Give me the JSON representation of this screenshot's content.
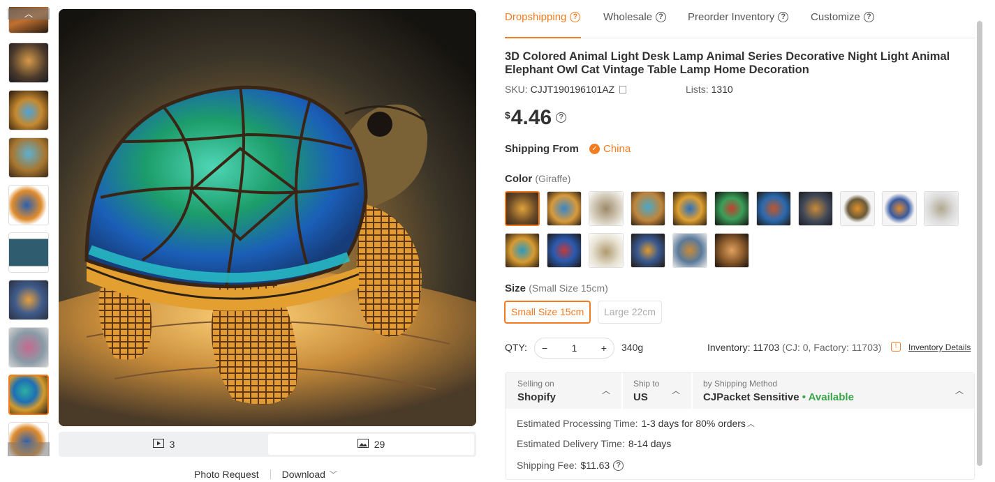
{
  "gallery": {
    "thumbnails": [
      "thumb-1",
      "thumb-2",
      "thumb-3",
      "thumb-4",
      "thumb-5",
      "thumb-6",
      "thumb-7",
      "thumb-8",
      "thumb-9",
      "thumb-10"
    ],
    "active_thumbnail": 9,
    "video_count": "3",
    "image_count": "29",
    "photo_request": "Photo Request",
    "download": "Download"
  },
  "tabs": [
    {
      "label": "Dropshipping",
      "active": true
    },
    {
      "label": "Wholesale",
      "active": false
    },
    {
      "label": "Preorder Inventory",
      "active": false
    },
    {
      "label": "Customize",
      "active": false
    }
  ],
  "product": {
    "title": "3D Colored Animal Light Desk Lamp Animal Series Decorative Night Light Animal Elephant Owl Cat Vintage Table Lamp Home Decoration",
    "sku_label": "SKU:",
    "sku": "CJJT190196101AZ",
    "lists_label": "Lists:",
    "lists": "1310",
    "currency": "$",
    "price": "4.46",
    "shipping_from_label": "Shipping From",
    "shipping_from": "China"
  },
  "color": {
    "label": "Color",
    "selected": "(Giraffe)",
    "swatch_count": 18,
    "active_index": 0
  },
  "size": {
    "label": "Size",
    "selected": "(Small Size 15cm)",
    "options": [
      {
        "label": "Small Size 15cm",
        "active": true
      },
      {
        "label": "Large 22cm",
        "active": false
      }
    ]
  },
  "quantity": {
    "label": "QTY:",
    "value": "1",
    "minus": "−",
    "plus": "+",
    "weight": "340g"
  },
  "inventory": {
    "label": "Inventory:",
    "value": "11703",
    "breakdown": "(CJ: 0, Factory: 11703)",
    "details_link": "Inventory Details"
  },
  "shipping": {
    "selling_on_label": "Selling on",
    "selling_on": "Shopify",
    "ship_to_label": "Ship to",
    "ship_to": "US",
    "method_label": "by Shipping Method",
    "method": "CJPacket Sensitive",
    "availability": "• Available",
    "processing_label": "Estimated Processing Time:",
    "processing": "1-3 days for 80% orders",
    "delivery_label": "Estimated Delivery Time:",
    "delivery": "8-14 days",
    "fee_label": "Shipping Fee:",
    "fee": "$11.63"
  },
  "colors": {
    "accent": "#f47b20",
    "available": "#3aa54a"
  }
}
